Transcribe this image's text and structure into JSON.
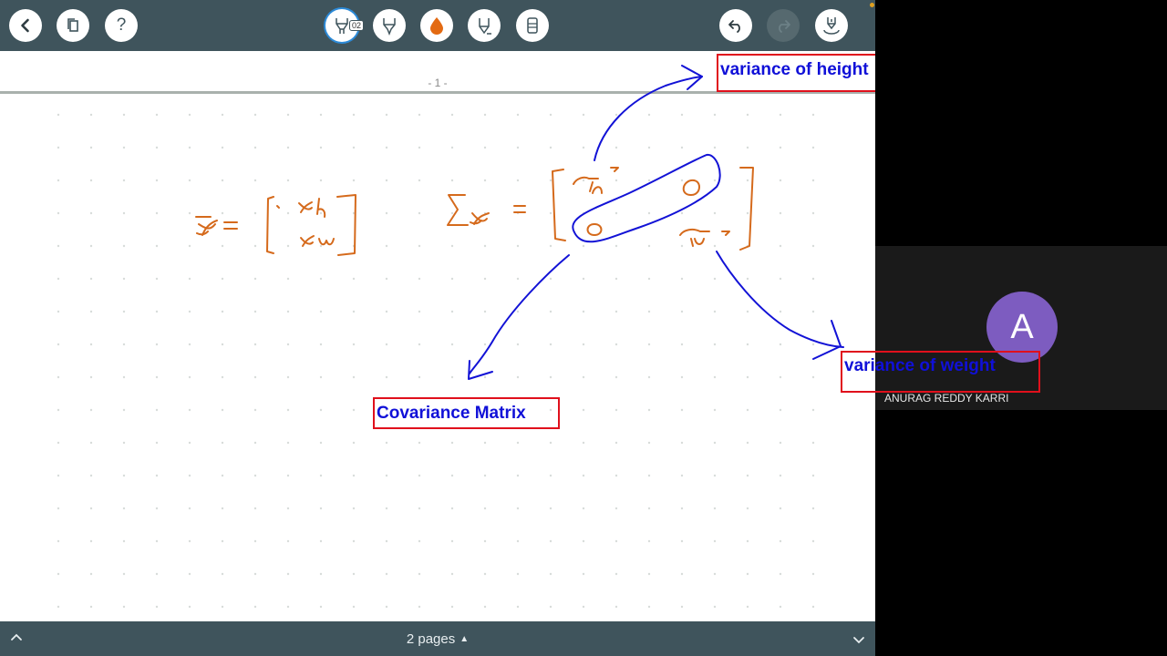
{
  "toolbar": {
    "back_icon": "chevron-left-icon",
    "pages_icon": "copy-pages-icon",
    "help_label": "?",
    "pen_badge": "02",
    "tools": [
      "pen-tool-icon",
      "highlighter-tool-icon",
      "color-drop-icon",
      "pencil-tool-icon",
      "eraser-tool-icon"
    ],
    "undo_icon": "undo-icon",
    "redo_icon": "redo-icon",
    "laser_icon": "laser-pointer-icon",
    "accent_color": "#e36a12"
  },
  "canvas": {
    "page_number": "- 1 -",
    "labels": {
      "variance_height": "variance of height",
      "variance_weight": "variance of weight",
      "covariance_matrix": "Covariance Matrix"
    },
    "ink_colors": {
      "orange": "#d56a1c",
      "blue": "#1212d6",
      "box": "#e0101c"
    }
  },
  "bottombar": {
    "pages_label": "2 pages",
    "caret": "▲"
  },
  "video": {
    "avatar_initial": "A",
    "participant_name": "ANURAG REDDY KARRI",
    "avatar_color": "#7d5cc0"
  }
}
